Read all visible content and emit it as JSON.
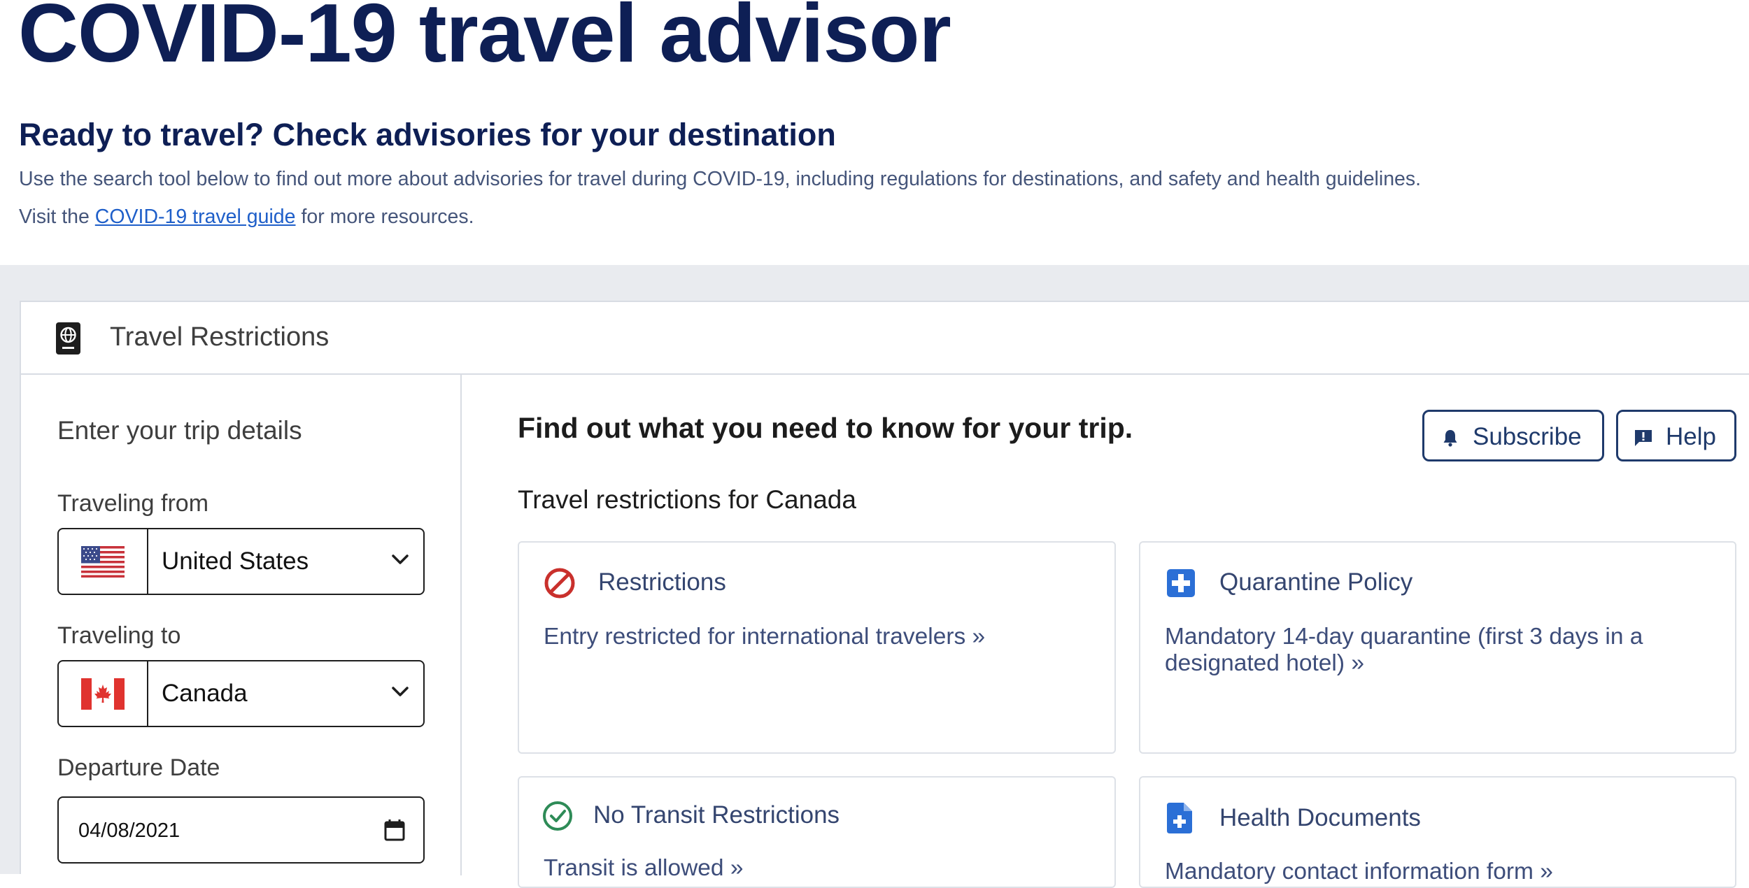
{
  "page": {
    "title": "COVID-19 travel advisor",
    "subheading": "Ready to travel? Check advisories for your destination",
    "intro": "Use the search tool below to find out more about advisories for travel during COVID-19, including regulations for destinations, and safety and health guidelines.",
    "visit_prefix": "Visit the",
    "visit_link": "COVID-19 travel guide",
    "visit_suffix": "for more resources."
  },
  "card": {
    "title": "Travel Restrictions",
    "icon": "passport-icon"
  },
  "form": {
    "heading": "Enter your trip details",
    "from_label": "Traveling from",
    "from_value": "United States",
    "from_flag": "us-flag-icon",
    "to_label": "Traveling to",
    "to_value": "Canada",
    "to_flag": "canada-flag-icon",
    "date_label": "Departure Date",
    "date_value": "04/08/2021"
  },
  "results": {
    "heading": "Find out what you need to know for your trip.",
    "subheading": "Travel restrictions for Canada",
    "subscribe_label": "Subscribe",
    "help_label": "Help",
    "cards": [
      {
        "title": "Restrictions",
        "text": "Entry restricted for international travelers »",
        "icon": "no-entry-icon",
        "color": "#c9302c"
      },
      {
        "title": "Quarantine Policy",
        "text": "Mandatory 14-day quarantine (first 3 days in a designated hotel) »",
        "icon": "medical-cross-icon",
        "color": "#2b6fd6"
      },
      {
        "title": "No Transit Restrictions",
        "text": "Transit is allowed »",
        "icon": "check-circle-icon",
        "color": "#2e8b57"
      },
      {
        "title": "Health Documents",
        "text": "Mandatory contact information form »",
        "icon": "medical-document-icon",
        "color": "#2b6fd6"
      }
    ]
  },
  "colors": {
    "title": "#0e1f55",
    "link": "#1f5fc9",
    "button_border": "#1f3a6b",
    "band": "#e9ebef"
  }
}
